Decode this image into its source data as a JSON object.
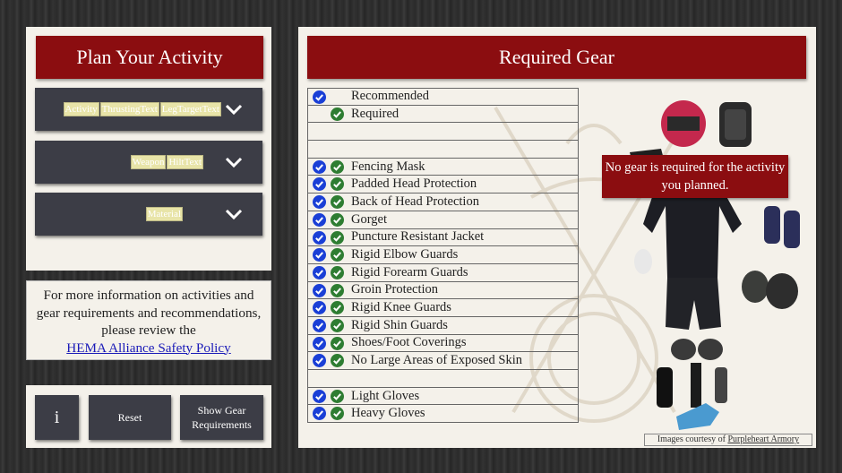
{
  "plan": {
    "title": "Plan Your Activity",
    "activity_tags": [
      "Activity",
      "ThrustingText",
      "LegTargetText"
    ],
    "weapon_tags": [
      "Weapon",
      "HiltText"
    ],
    "material_tags": [
      "Material"
    ]
  },
  "info": {
    "text": "For more information on activities and gear requirements and recommendations, please review the",
    "link": "HEMA Alliance Safety Policy"
  },
  "buttons": {
    "info": "i",
    "reset": "Reset",
    "show": "Show Gear Requirements"
  },
  "gear": {
    "title": "Required Gear",
    "rows": [
      {
        "label": "Recommended",
        "blue": true,
        "green": false
      },
      {
        "label": "Required",
        "blue": false,
        "green": true
      },
      {
        "label": "",
        "blue": false,
        "green": false
      },
      {
        "label": "",
        "blue": false,
        "green": false
      },
      {
        "label": "Fencing Mask",
        "blue": true,
        "green": true
      },
      {
        "label": "Padded Head Protection",
        "blue": true,
        "green": true
      },
      {
        "label": "Back of Head Protection",
        "blue": true,
        "green": true
      },
      {
        "label": "Gorget",
        "blue": true,
        "green": true
      },
      {
        "label": "Puncture Resistant Jacket",
        "blue": true,
        "green": true
      },
      {
        "label": "Rigid Elbow Guards",
        "blue": true,
        "green": true
      },
      {
        "label": "Rigid Forearm Guards",
        "blue": true,
        "green": true
      },
      {
        "label": "Groin Protection",
        "blue": true,
        "green": true
      },
      {
        "label": "Rigid Knee Guards",
        "blue": true,
        "green": true
      },
      {
        "label": "Rigid Shin Guards",
        "blue": true,
        "green": true
      },
      {
        "label": "Shoes/Foot Coverings",
        "blue": true,
        "green": true
      },
      {
        "label": "No Large Areas of Exposed Skin",
        "blue": true,
        "green": true
      },
      {
        "label": "",
        "blue": false,
        "green": false
      },
      {
        "label": "Light Gloves",
        "blue": true,
        "green": true
      },
      {
        "label": "Heavy Gloves",
        "blue": true,
        "green": true
      }
    ],
    "notice": "No gear is required for the activity you planned.",
    "credit_prefix": "Images courtesy of",
    "credit_link": "Purpleheart Armory"
  },
  "colors": {
    "banner": "#8b0d10",
    "panel": "#f4f1ea",
    "dropdown": "#3c3d46",
    "recommended_check": "#1a3fd6",
    "required_check": "#2e7d32"
  }
}
